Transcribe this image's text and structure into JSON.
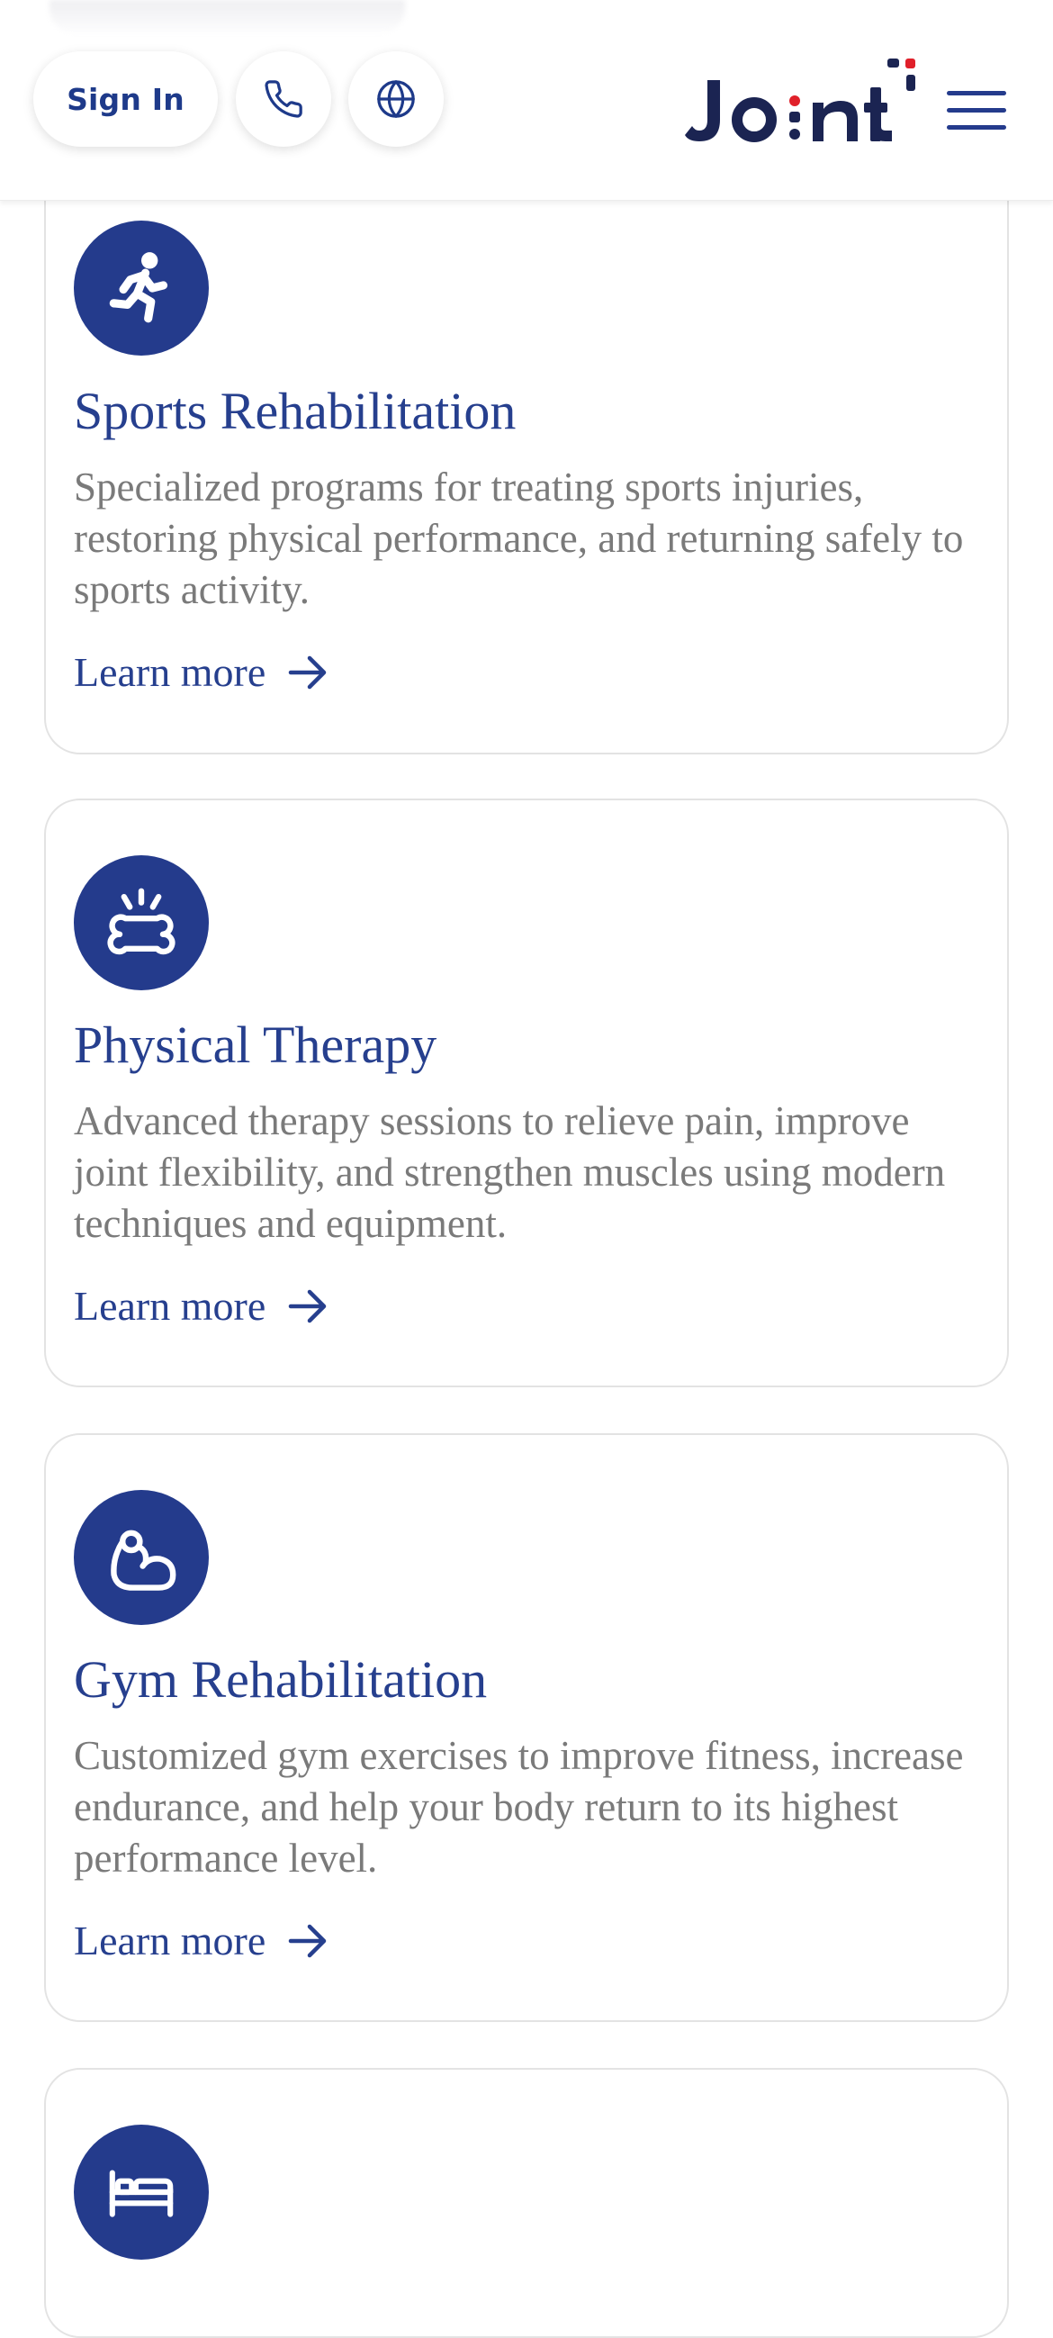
{
  "header": {
    "signin_label": "Sign In",
    "logo_text": "Joint",
    "phone_icon": "phone-icon",
    "globe_icon": "globe-icon",
    "menu_icon": "hamburger-menu-icon"
  },
  "colors": {
    "brand_blue": "#243b8c",
    "logo_navy": "#1b2452",
    "logo_red": "#e0202a",
    "description_gray": "#7a7a7a"
  },
  "services": [
    {
      "icon": "running-person-icon",
      "title": "Sports Rehabilitation",
      "description": "Specialized programs for treating sports injuries, restoring physical performance, and returning safely to sports activity.",
      "link_label": "Learn more"
    },
    {
      "icon": "bone-pain-icon",
      "title": "Physical Therapy",
      "description": "Advanced therapy sessions to relieve pain, improve joint flexibility, and strengthen muscles using modern techniques and equipment.",
      "link_label": "Learn more"
    },
    {
      "icon": "flexed-arm-icon",
      "title": "Gym Rehabilitation",
      "description": "Customized gym exercises to improve fitness, increase endurance, and help your body return to its highest performance level.",
      "link_label": "Learn more"
    },
    {
      "icon": "bed-icon"
    }
  ]
}
